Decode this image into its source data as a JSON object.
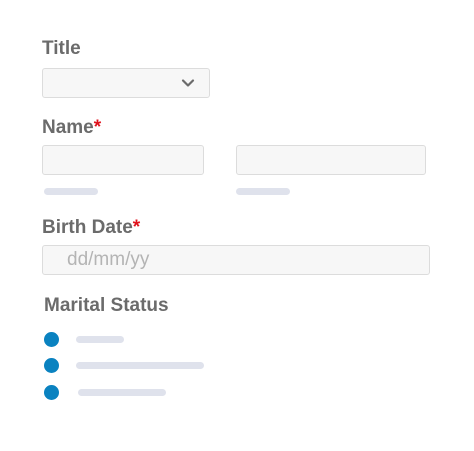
{
  "form": {
    "title_label": "Title",
    "title_select_value": "",
    "name_label": "Name",
    "required_mark": "*",
    "first_name_value": "",
    "last_name_value": "",
    "birth_label": "Birth Date",
    "birth_placeholder": "dd/mm/yy",
    "marital_label": "Marital Status",
    "marital_options": [
      {
        "label": "",
        "selected": true
      },
      {
        "label": "",
        "selected": true
      },
      {
        "label": "",
        "selected": true
      }
    ]
  },
  "colors": {
    "label_text": "#6b6b6b",
    "required": "#e0121c",
    "radio_fill": "#0a82c0",
    "placeholder_bar": "#dfe2ec",
    "field_background": "#f7f7f7",
    "field_border": "#dcdcdc"
  },
  "icons": {
    "title_select_arrow": "chevron-down-icon"
  }
}
